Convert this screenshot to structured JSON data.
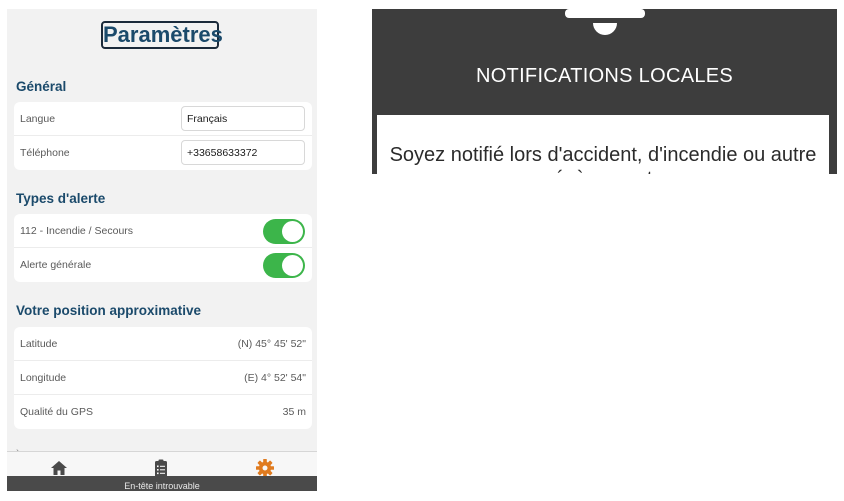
{
  "settings": {
    "title": "Paramètres",
    "sections": {
      "general": {
        "title": "Général",
        "language_label": "Langue",
        "language_value": "Français",
        "phone_label": "Téléphone",
        "phone_value": "+33658633372"
      },
      "alerts": {
        "title": "Types d'alerte",
        "items": [
          {
            "label": "112 - Incendie / Secours",
            "enabled": true
          },
          {
            "label": "Alerte générale",
            "enabled": true
          }
        ]
      },
      "position": {
        "title": "Votre position approximative",
        "latitude_label": "Latitude",
        "latitude_value": "(N) 45° 45' 52\"",
        "longitude_label": "Longitude",
        "longitude_value": "(E) 4° 52' 54\"",
        "gps_label": "Qualité du GPS",
        "gps_value": "35 m"
      }
    },
    "tabbar": {
      "active_color": "#e07b1f",
      "inactive_color": "#4a4a4a",
      "icons": [
        "home-icon",
        "clipboard-list-icon",
        "gear-icon"
      ]
    },
    "footer_text": "En-tête introuvable"
  },
  "notification_panel": {
    "heading": "NOTIFICATIONS LOCALES",
    "message": "Soyez notifié lors d'accident, d'incendie ou autre évènement"
  }
}
